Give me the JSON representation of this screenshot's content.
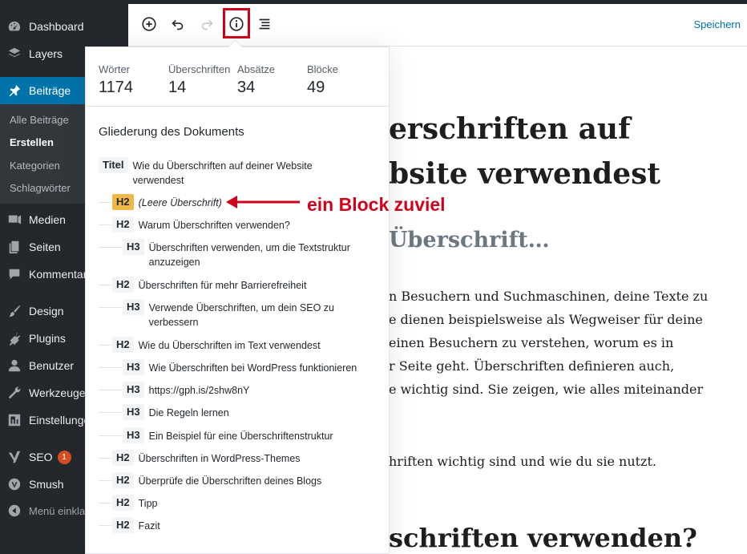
{
  "sidebar": {
    "items": [
      {
        "label": "Dashboard",
        "icon": "dashboard-icon"
      },
      {
        "label": "Layers",
        "icon": "layers-icon"
      },
      {
        "label": "Beiträge",
        "icon": "pin-icon",
        "active": true
      },
      {
        "label": "Medien",
        "icon": "media-icon"
      },
      {
        "label": "Seiten",
        "icon": "pages-icon"
      },
      {
        "label": "Kommentare",
        "icon": "comments-icon"
      },
      {
        "label": "Design",
        "icon": "brush-icon"
      },
      {
        "label": "Plugins",
        "icon": "plugins-icon"
      },
      {
        "label": "Benutzer",
        "icon": "users-icon"
      },
      {
        "label": "Werkzeuge",
        "icon": "tools-icon"
      },
      {
        "label": "Einstellungen",
        "icon": "settings-icon"
      },
      {
        "label": "SEO",
        "icon": "seo-icon",
        "badge": "1"
      },
      {
        "label": "Smush",
        "icon": "smush-icon"
      },
      {
        "label": "Menü einklappen",
        "icon": "collapse-icon"
      }
    ],
    "submenu": [
      "Alle Beiträge",
      "Erstellen",
      "Kategorien",
      "Schlagwörter"
    ],
    "current_sub": "Erstellen"
  },
  "toolbar": {
    "icons": [
      "add-block-icon",
      "undo-icon",
      "redo-icon",
      "info-icon",
      "outline-icon"
    ],
    "save_label": "Speichern",
    "highlight_color": "#d0021b",
    "accent": "#0073aa"
  },
  "stats": {
    "words_label": "Wörter",
    "words": "1174",
    "headings_label": "Überschriften",
    "headings": "14",
    "paragraphs_label": "Absätze",
    "paragraphs": "34",
    "blocks_label": "Blöcke",
    "blocks": "49"
  },
  "outline": {
    "title": "Gliederung des Dokuments",
    "items": [
      {
        "level": "Titel",
        "text": "Wie du Überschriften auf deiner Website verwendest"
      },
      {
        "level": "H2",
        "text": "(Leere Überschrift)",
        "warning": true
      },
      {
        "level": "H2",
        "text": "Warum Überschriften verwenden?"
      },
      {
        "level": "H3",
        "text": "Überschriften verwenden, um die Textstruktur anzuzeigen"
      },
      {
        "level": "H2",
        "text": "Überschriften für mehr Barrierefreiheit"
      },
      {
        "level": "H3",
        "text": "Verwende Überschriften, um dein SEO zu verbessern"
      },
      {
        "level": "H2",
        "text": "Wie du Überschriften im Text verwendest"
      },
      {
        "level": "H3",
        "text": "Wie Überschriften bei WordPress funktionieren"
      },
      {
        "level": "H3",
        "text": "https://gph.is/2shw8nY"
      },
      {
        "level": "H3",
        "text": "Die Regeln lernen"
      },
      {
        "level": "H3",
        "text": "Ein Beispiel für eine Überschriftenstruktur"
      },
      {
        "level": "H2",
        "text": "Überschriften in WordPress-Themes"
      },
      {
        "level": "H2",
        "text": "Überprüfe die Überschriften deines Blogs"
      },
      {
        "level": "H2",
        "text": "Tipp"
      },
      {
        "level": "H2",
        "text": "Fazit"
      }
    ]
  },
  "annotation": {
    "text": "ein Block zuviel",
    "color": "#d0021b"
  },
  "editor": {
    "title_line1": "erschriften auf",
    "title_line2": "bsite verwendest",
    "subheading": "Überschrift…",
    "paragraph_lines": [
      "n Besuchern und Suchmaschinen, deine Texte zu",
      "e dienen beispielsweise als Wegweiser für deine",
      "einen Besuchern zu verstehen, worum es in",
      "r Seite geht. Überschriften definieren auch,",
      "e wichtig sind. Sie zeigen, wie alles miteinander"
    ],
    "paragraph2": "hriften wichtig sind und wie du sie nutzt.",
    "heading2": "schriften verwenden?"
  }
}
